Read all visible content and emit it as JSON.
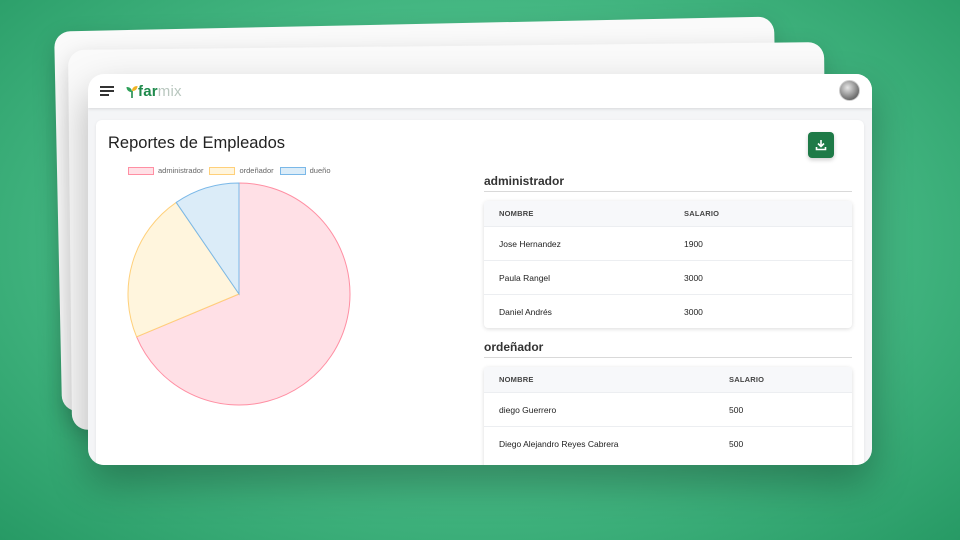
{
  "app": {
    "brand_main": "far",
    "brand_light": "mix"
  },
  "page": {
    "title": "Reportes de Empleados"
  },
  "chart_data": {
    "type": "pie",
    "categories": [
      "administrador",
      "ordeñador",
      "dueño"
    ],
    "values": [
      7900,
      2500,
      1100
    ],
    "colors_fill": [
      "#ffe0e6",
      "#fff5dd",
      "#dbecf8"
    ],
    "colors_border": [
      "#ff8fa3",
      "#ffd07a",
      "#7ab8e8"
    ],
    "legend": "top-left"
  },
  "sections": [
    {
      "title": "administrador",
      "columns": [
        "NOMBRE",
        "SALARIO"
      ],
      "rows": [
        [
          "Jose Hernandez",
          "1900"
        ],
        [
          "Paula Rangel",
          "3000"
        ],
        [
          "Daniel Andrés",
          "3000"
        ]
      ]
    },
    {
      "title": "ordeñador",
      "columns": [
        "NOMBRE",
        "SALARIO"
      ],
      "rows": [
        [
          "diego Guerrero",
          "500"
        ],
        [
          "Diego Alejandro Reyes Cabrera",
          "500"
        ]
      ]
    }
  ],
  "icons": {
    "menu": "hamburger-icon",
    "download": "download-icon",
    "logo": "sprout-icon"
  },
  "colors": {
    "accent": "#1e7a47",
    "background": "#4cbf8a"
  }
}
